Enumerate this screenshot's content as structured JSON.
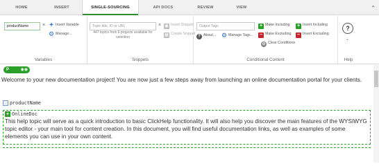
{
  "tabs": [
    {
      "label": "HOME",
      "active": false
    },
    {
      "label": "INSERT",
      "active": false
    },
    {
      "label": "SINGLE-SOURCING",
      "active": true
    },
    {
      "label": "API DOCS",
      "active": false
    },
    {
      "label": "REVIEW",
      "active": false
    },
    {
      "label": "VIEW",
      "active": false
    }
  ],
  "ribbon": {
    "variables": {
      "field_value": "productName",
      "insert_label": "Insert Variable",
      "manage_label": "Manage...",
      "group_label": "Variables"
    },
    "snippets": {
      "field_placeholder": "Topic title, ID or URL",
      "insert_label": "Insert Snippet",
      "create_label": "Create Snippet",
      "note": "447 topics from 6 projects available for selection",
      "group_label": "Snippets"
    },
    "conditional": {
      "field_placeholder": "Output Tags",
      "about_label": "About...",
      "manage_tags_label": "Manage Tags...",
      "make_including_label": "Make Including",
      "insert_including_label": "Insert Including",
      "make_excluding_label": "Make Excluding",
      "insert_excluding_label": "Insert Excluding",
      "clear_label": "Clear Conditions",
      "group_label": "Conditional Content"
    },
    "help": {
      "icon_text": "?",
      "group_label": "Help"
    }
  },
  "editor": {
    "condition_chip": "P",
    "intro": "Welcome to your new documentation project! You are now just a few steps away from launching an online documentation portal for your clients.",
    "variable_name": "productName",
    "condition_tag": "OnlineDoc",
    "conditional_text": "This help topic will serve as a quick introduction to basic ClickHelp functionality. It will also help you discover the main features of the WYSIWYG topic editor - your main tool for content creation. In this document, you will find useful documentation links, as well as examples of some elements you can use in your own content."
  },
  "colors": {
    "accent_green": "#2aa02a",
    "danger_red": "#c4262e",
    "link_blue": "#2b6cc4"
  }
}
